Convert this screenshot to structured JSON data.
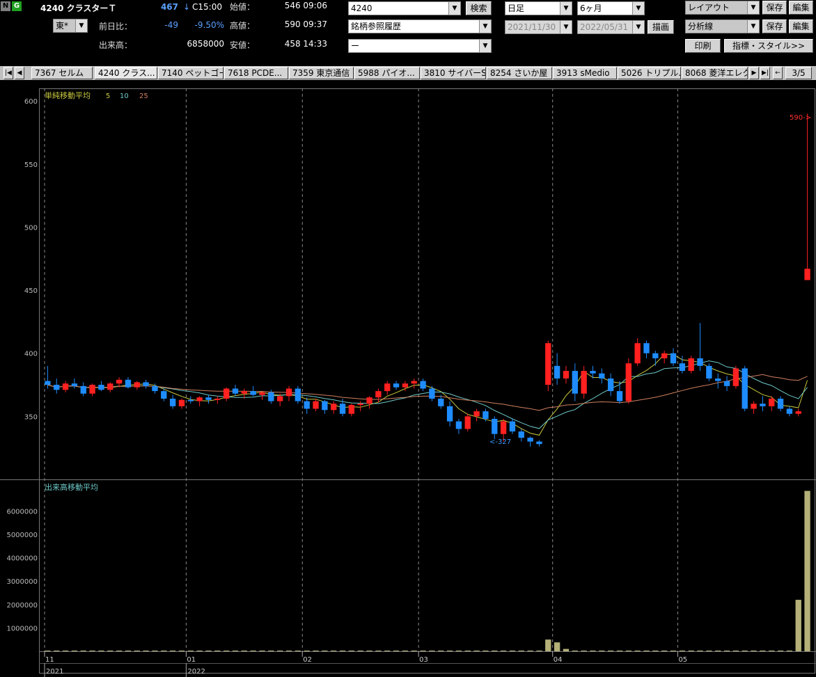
{
  "header": {
    "badge_n": "N",
    "badge_g": "G",
    "symbol_title": "4240 クラスターＴ",
    "current_price": "467",
    "price_arrow": "↓",
    "close_time": "C15:00",
    "market_select": "東*",
    "change_label": "前日比：",
    "change_value": "-49",
    "change_pct": "-9.50%",
    "volume_label": "出来高：",
    "volume_value": "6858000",
    "open_label": "始値：",
    "open_value": "546 09:06",
    "high_label": "高値：",
    "high_value": "590 09:37",
    "low_label": "安値：",
    "low_value": "458 14:33"
  },
  "search": {
    "code_value": "4240",
    "search_button": "検索",
    "history_select": "銘柄参照履歴",
    "sub_select": "ー"
  },
  "period": {
    "interval_select": "日足",
    "range_select": "6ヶ月",
    "start_date": "2021/11/30",
    "end_date": "2022/05/31",
    "draw_button": "描画"
  },
  "layout": {
    "layout_select": "レイアウト",
    "save_button_1": "保存",
    "edit_button_1": "編集",
    "analysis_select": "分析線",
    "save_button_2": "保存",
    "edit_button_2": "編集",
    "print_button": "印刷",
    "indicator_button": "指標・スタイル>>"
  },
  "tabs": {
    "items": [
      "7367 セルム",
      "4240 クラス...",
      "7140 ペットゴー",
      "7618 PCDE...",
      "7359 東京通信",
      "5988 パイオ...",
      "3810 サイバーS",
      "8254 さいか屋",
      "3913 sMedio",
      "5026 トリプル...",
      "8068 菱洋エレク"
    ],
    "page_indicator": "3/5"
  },
  "chart": {
    "ma_label": "単純移動平均",
    "ma_periods": [
      "5",
      "10",
      "25"
    ],
    "volume_label": "出来高移動平均",
    "price_ticks": [
      "600",
      "550",
      "500",
      "450",
      "400",
      "350"
    ],
    "volume_ticks": [
      "6000000",
      "5000000",
      "4000000",
      "3000000",
      "2000000",
      "1000000"
    ],
    "month_labels": [
      "11",
      "01",
      "02",
      "03",
      "04",
      "05"
    ],
    "year_labels": [
      "2021",
      "2022"
    ],
    "high_marker": "590->",
    "low_marker": "<-327"
  },
  "chart_data": {
    "type": "candlestick",
    "price_ylim": [
      300,
      610
    ],
    "volume_ylim": [
      0,
      7200000
    ],
    "candles": [
      [
        378,
        390,
        372,
        375
      ],
      [
        375,
        380,
        368,
        371
      ],
      [
        371,
        378,
        369,
        376
      ],
      [
        376,
        380,
        372,
        374
      ],
      [
        374,
        377,
        366,
        368
      ],
      [
        368,
        376,
        366,
        375
      ],
      [
        375,
        378,
        370,
        371
      ],
      [
        371,
        377,
        369,
        376
      ],
      [
        376,
        381,
        373,
        379
      ],
      [
        379,
        381,
        372,
        373
      ],
      [
        373,
        378,
        371,
        377
      ],
      [
        377,
        379,
        372,
        374
      ],
      [
        374,
        376,
        368,
        370
      ],
      [
        370,
        372,
        362,
        364
      ],
      [
        364,
        367,
        356,
        358
      ],
      [
        358,
        364,
        356,
        363
      ],
      [
        363,
        366,
        360,
        362
      ],
      [
        362,
        366,
        358,
        365
      ],
      [
        365,
        367,
        360,
        363
      ],
      [
        363,
        366,
        360,
        364
      ],
      [
        364,
        373,
        362,
        372
      ],
      [
        372,
        375,
        366,
        368
      ],
      [
        368,
        372,
        364,
        370
      ],
      [
        370,
        374,
        366,
        367
      ],
      [
        367,
        370,
        363,
        369
      ],
      [
        369,
        371,
        360,
        362
      ],
      [
        362,
        368,
        358,
        366
      ],
      [
        366,
        374,
        362,
        372
      ],
      [
        372,
        374,
        360,
        362
      ],
      [
        362,
        365,
        352,
        356
      ],
      [
        356,
        364,
        354,
        362
      ],
      [
        362,
        363,
        352,
        355
      ],
      [
        355,
        362,
        352,
        360
      ],
      [
        360,
        364,
        350,
        352
      ],
      [
        352,
        360,
        350,
        359
      ],
      [
        359,
        362,
        354,
        360
      ],
      [
        360,
        366,
        356,
        365
      ],
      [
        365,
        372,
        361,
        370
      ],
      [
        370,
        378,
        367,
        376
      ],
      [
        376,
        378,
        371,
        373
      ],
      [
        373,
        378,
        370,
        376
      ],
      [
        376,
        380,
        372,
        378
      ],
      [
        378,
        380,
        370,
        372
      ],
      [
        372,
        374,
        362,
        364
      ],
      [
        364,
        367,
        356,
        358
      ],
      [
        358,
        362,
        342,
        346
      ],
      [
        346,
        348,
        336,
        340
      ],
      [
        340,
        352,
        338,
        350
      ],
      [
        350,
        356,
        346,
        354
      ],
      [
        354,
        356,
        346,
        348
      ],
      [
        348,
        350,
        332,
        336
      ],
      [
        336,
        348,
        330,
        346
      ],
      [
        346,
        348,
        336,
        338
      ],
      [
        338,
        340,
        330,
        333
      ],
      [
        333,
        334,
        326,
        330
      ],
      [
        330,
        331,
        326,
        328
      ],
      [
        375,
        410,
        370,
        408
      ],
      [
        390,
        400,
        375,
        380
      ],
      [
        380,
        390,
        376,
        386
      ],
      [
        386,
        392,
        362,
        368
      ],
      [
        368,
        390,
        364,
        386
      ],
      [
        386,
        390,
        380,
        384
      ],
      [
        384,
        388,
        376,
        380
      ],
      [
        380,
        384,
        366,
        370
      ],
      [
        370,
        378,
        360,
        362
      ],
      [
        362,
        396,
        360,
        392
      ],
      [
        392,
        412,
        390,
        408
      ],
      [
        408,
        410,
        396,
        400
      ],
      [
        400,
        402,
        390,
        396
      ],
      [
        396,
        402,
        392,
        400
      ],
      [
        400,
        404,
        390,
        392
      ],
      [
        392,
        398,
        384,
        386
      ],
      [
        386,
        398,
        384,
        396
      ],
      [
        396,
        424,
        386,
        390
      ],
      [
        390,
        392,
        378,
        380
      ],
      [
        380,
        384,
        372,
        378
      ],
      [
        378,
        382,
        370,
        374
      ],
      [
        374,
        390,
        372,
        388
      ],
      [
        388,
        390,
        354,
        356
      ],
      [
        356,
        362,
        352,
        360
      ],
      [
        360,
        366,
        354,
        358
      ],
      [
        358,
        366,
        354,
        364
      ],
      [
        364,
        366,
        354,
        356
      ],
      [
        356,
        358,
        350,
        352
      ],
      [
        352,
        356,
        350,
        354
      ],
      [
        458,
        590,
        458,
        467
      ]
    ],
    "volume": [
      0,
      0,
      0,
      0,
      0,
      0,
      0,
      0,
      0,
      0,
      0,
      0,
      0,
      0,
      0,
      0,
      0,
      0,
      0,
      0,
      0,
      0,
      0,
      0,
      0,
      0,
      0,
      0,
      0,
      0,
      0,
      0,
      0,
      0,
      0,
      0,
      0,
      0,
      0,
      0,
      0,
      0,
      0,
      0,
      0,
      0,
      0,
      0,
      0,
      0,
      0,
      0,
      0,
      0,
      0,
      0,
      500000,
      380000,
      100000,
      0,
      0,
      0,
      0,
      0,
      0,
      0,
      0,
      0,
      0,
      0,
      0,
      0,
      0,
      0,
      0,
      0,
      0,
      0,
      0,
      0,
      0,
      0,
      0,
      0,
      2200000,
      6858000
    ],
    "ma": [
      {
        "name": "5",
        "color": "#c8c840"
      },
      {
        "name": "10",
        "color": "#6ec8c8"
      },
      {
        "name": "25",
        "color": "#d08060"
      }
    ]
  },
  "colors": {
    "up": "#ff2020",
    "down": "#1e8cff",
    "volume_bar": "#b4b078",
    "grid": "#8a8a8a"
  }
}
